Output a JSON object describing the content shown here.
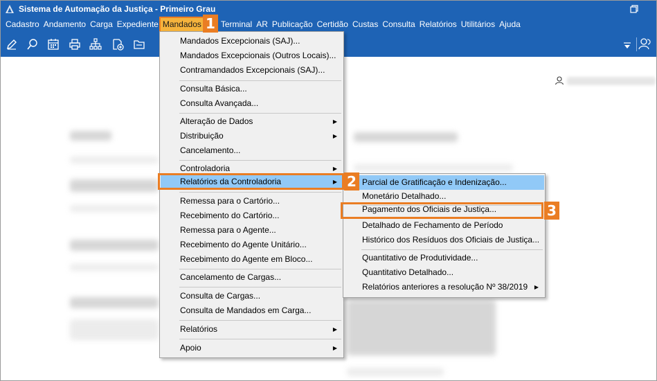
{
  "window": {
    "title": "Sistema de Automação da Justiça - Primeiro Grau",
    "icon": "app-logo-icon",
    "restore_icon": "restore-window-icon"
  },
  "menubar": {
    "items": [
      "Cadastro",
      "Andamento",
      "Carga",
      "Expediente",
      "Mandados",
      "Terminal",
      "AR",
      "Publicação",
      "Certidão",
      "Custas",
      "Consulta",
      "Relatórios",
      "Utilitários",
      "Ajuda"
    ],
    "active": "Mandados"
  },
  "toolbar": {
    "icons": [
      "edit-icon",
      "search-process-icon",
      "calendar-icon",
      "printer-icon",
      "hierarchy-icon",
      "add-document-icon",
      "folder-icon"
    ],
    "right_icons": [
      "dropdown-icon",
      "users-icon"
    ]
  },
  "mandados_menu": {
    "items": [
      "Mandados Excepcionais (SAJ)...",
      "Mandados Excepcionais (Outros Locais)...",
      "Contramandados Excepcionais (SAJ)...",
      "Consulta Básica...",
      "Consulta Avançada...",
      "Alteração de Dados",
      "Distribuição",
      "Cancelamento...",
      "Controladoria",
      "Relatórios da Controladoria",
      "Remessa para o Cartório...",
      "Recebimento do Cartório...",
      "Remessa para o Agente...",
      "Recebimento do Agente Unitário...",
      "Recebimento do Agente em Bloco...",
      "Cancelamento de Cargas...",
      "Consulta de Cargas...",
      "Consulta de Mandados em Carga...",
      "Relatórios",
      "Apoio"
    ]
  },
  "relatorios_menu": {
    "items": [
      "Parcial de Gratificação e Indenização...",
      "Monetário Detalhado...",
      "Pagamento dos Oficiais de Justiça...",
      "Detalhado de Fechamento de Período",
      "Histórico dos Resíduos dos Oficiais de Justiça...",
      "Quantitativo de Produtividade...",
      "Quantitativo Detalhado...",
      "Relatórios anteriores a resolução Nº 38/2019"
    ]
  },
  "steps": [
    "1",
    "2",
    "3"
  ],
  "colors": {
    "titlebar": "#1e63b5",
    "highlight": "#91c9f7",
    "callout": "#ea7d23",
    "menu_bg": "#f0f0f0"
  }
}
